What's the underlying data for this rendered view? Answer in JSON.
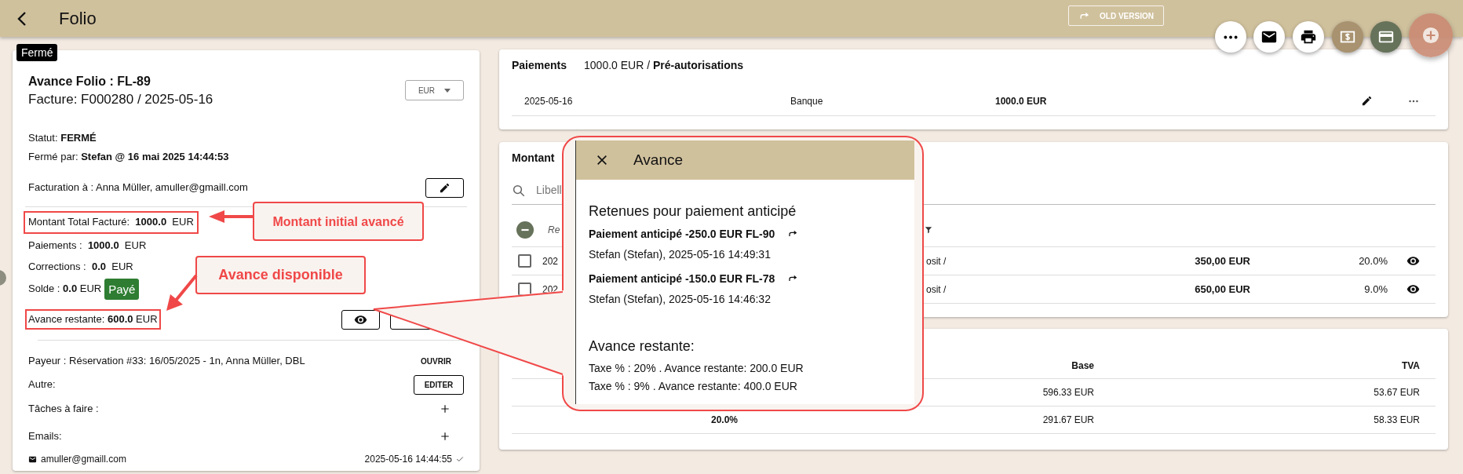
{
  "app_bar": {
    "title": "Folio",
    "old_version_button": "OLD VERSION"
  },
  "folio": {
    "status_badge": "Fermé",
    "title": "Avance Folio : FL-89",
    "invoice": "Facture: F000280 / 2025-05-16",
    "currency": "EUR",
    "status": "Statut: **FERMÉ**",
    "closed_by": "Fermé par: **Stefan @ 16 mai 2025 14:44:53**",
    "billing": "Facturation à : Anna Müller, amuller@gmaill.com",
    "total_billed": "Montant Total Facturé:  **1000.0**  EUR",
    "payments": "Paiements :  **1000.0**  EUR",
    "corrections": "Corrections :  **0.0**  EUR",
    "balance": "Solde : **0.0** EUR",
    "paid_badge": "Payé",
    "remaining_advance": "Avance restante: **600.0** EUR",
    "payer": "Payeur : Réservation #33: 16/05/2025 - 1n, Anna Müller, DBL",
    "open_button": "OUVRIR",
    "other_label": "Autre:",
    "edit_button": "EDITER",
    "tasks_label": "Tâches à faire :",
    "emails_label": "Emails:",
    "emails": [
      {
        "address": "amuller@gmaill.com",
        "sent": "2025-05-16 14:44:55",
        "delivered": true
      }
    ]
  },
  "payments_card": {
    "title": "Paiements",
    "summary": "1000.0 EUR / **Pré-autorisations**",
    "rows": [
      {
        "date": "2025-05-16",
        "method": "Banque",
        "amount": "1000.0 EUR"
      }
    ]
  },
  "charges_card": {
    "title": "Montant",
    "search_placeholder": "Libell",
    "header_column_1": "Re",
    "rows": [
      {
        "checked": false,
        "column_1": "202",
        "column_2": "osit /",
        "amount": "350,00 EUR",
        "tax": "20.0%"
      },
      {
        "checked": false,
        "column_1": "202",
        "column_2": "osit /",
        "amount": "650,00 EUR",
        "tax": "9.0%"
      }
    ]
  },
  "tax_card": {
    "columns": [
      "Base",
      "TVA"
    ],
    "rows": [
      {
        "base": "596.33 EUR",
        "vat": "53.67 EUR"
      },
      {
        "rate": "20.0%",
        "base": "291.67 EUR",
        "vat": "58.33 EUR"
      }
    ]
  },
  "advance_dialog": {
    "title": "Avance",
    "section_title": "Retenues pour paiement anticipé",
    "entries": [
      {
        "title": "Paiement anticipé -250.0 EUR FL-90",
        "meta": "Stefan (Stefan), 2025-05-16 14:49:31"
      },
      {
        "title": "Paiement anticipé -150.0 EUR FL-78",
        "meta": "Stefan (Stefan), 2025-05-16 14:46:32"
      }
    ],
    "remaining_title": "Avance restante:",
    "remaining_lines": [
      "Taxe % : 20% . Avance restante: 200.0 EUR",
      "Taxe % : 9% . Avance restante: 400.0 EUR"
    ]
  },
  "annotations": [
    "Montant initial avancé",
    "Avance disponible"
  ]
}
